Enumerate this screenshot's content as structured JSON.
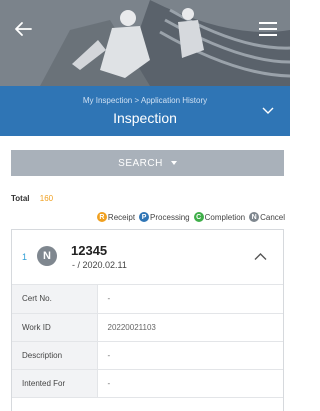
{
  "hero": {
    "icons": {
      "back": "arrow-left-icon",
      "menu": "hamburger-menu-icon"
    }
  },
  "titlebar": {
    "breadcrumb": "My Inspection > Application History",
    "title": "Inspection",
    "toggle_icon": "chevron-down-icon"
  },
  "search": {
    "label": "SEARCH",
    "icon": "caret-down-icon"
  },
  "summary": {
    "total_label": "Total",
    "total_count": "160"
  },
  "legend": [
    {
      "letter": "R",
      "label": "Receipt",
      "color": "#f0a020"
    },
    {
      "letter": "P",
      "label": "Processing",
      "color": "#2f75b5"
    },
    {
      "letter": "C",
      "label": "Completion",
      "color": "#3fae49"
    },
    {
      "letter": "N",
      "label": "Cancel",
      "color": "#7f878f"
    }
  ],
  "card": {
    "index": "1",
    "status_letter": "N",
    "status_color": "#7f878f",
    "cert_number": "12345",
    "date_text": "- / 2020.02.11",
    "toggle_icon": "chevron-up-icon",
    "rows": [
      {
        "label": "Cert No.",
        "value": "-"
      },
      {
        "label": "Work ID",
        "value": "20220021103"
      },
      {
        "label": "Description",
        "value": "-"
      },
      {
        "label": "Intented For",
        "value": "-"
      }
    ]
  },
  "colors": {
    "primary": "#2f75b5",
    "search_bg": "#a9b1ba",
    "total_count": "#f0a020",
    "index": "#2f9fd6"
  }
}
